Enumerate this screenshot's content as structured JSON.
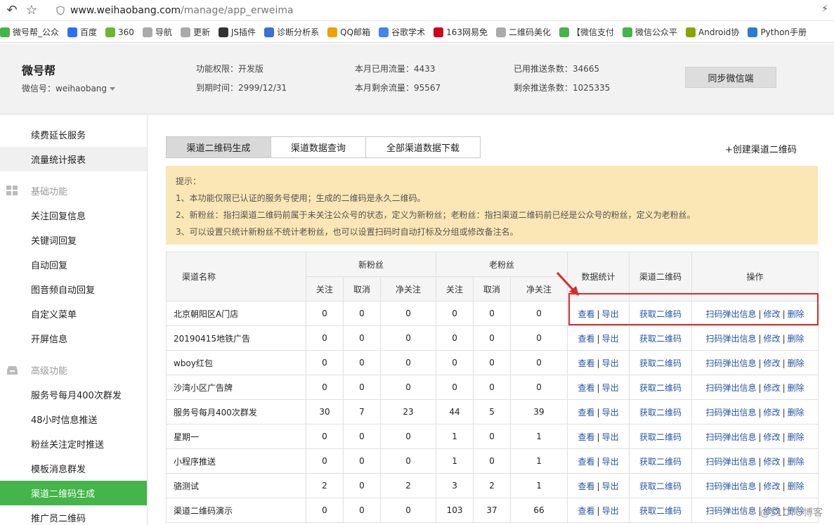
{
  "browser": {
    "url_host": "www.weihaobang.com",
    "url_path": "/manage/app_erweima",
    "bookmarks": [
      {
        "label": "微号帮_公众",
        "icon": "wechat-icon",
        "color": "#44b549"
      },
      {
        "label": "百度",
        "icon": "baidu-icon",
        "color": "#2d6ff7"
      },
      {
        "label": "360",
        "icon": "360-icon",
        "color": "#6ab82e"
      },
      {
        "label": "导航",
        "icon": "page-icon",
        "color": "#aaaaaa"
      },
      {
        "label": "更新",
        "icon": "page-icon",
        "color": "#aaaaaa"
      },
      {
        "label": "JS插件",
        "icon": "js-icon",
        "color": "#333333"
      },
      {
        "label": "诊断分析系",
        "icon": "diagnose-icon",
        "color": "#3a6fd8"
      },
      {
        "label": "QQ邮箱",
        "icon": "qqmail-icon",
        "color": "#f0a000"
      },
      {
        "label": "谷歌学术",
        "icon": "google-icon",
        "color": "#4285f4"
      },
      {
        "label": "163网易免",
        "icon": "163-icon",
        "color": "#d0021b"
      },
      {
        "label": "二维码美化",
        "icon": "page-icon",
        "color": "#aaaaaa"
      },
      {
        "label": "【微信支付",
        "icon": "wechat-icon",
        "color": "#44b549"
      },
      {
        "label": "微信公众平",
        "icon": "wechat-icon",
        "color": "#44b549"
      },
      {
        "label": "Android协",
        "icon": "android-icon",
        "color": "#8aa400"
      },
      {
        "label": "Python手册",
        "icon": "python-icon",
        "color": "#2b7bd0"
      }
    ]
  },
  "header": {
    "account_name": "微号帮",
    "wechat_id": "微信号：weihaobang",
    "permission": "功能权限：开发版",
    "expire": "到期时间：2999/12/31",
    "used_flow": "本月已用流量：4433",
    "remain_flow": "本月剩余流量：95567",
    "used_push": "已用推送条数：34665",
    "remain_push": "剩余推送条数：1025335",
    "sync_button": "同步微信端"
  },
  "sidebar": {
    "renew": "续费延长服务",
    "flow_report": "流量统计报表",
    "basic_group": "基础功能",
    "basic": [
      "关注回复信息",
      "关键词回复",
      "自动回复",
      "图音频自动回复",
      "自定义菜单",
      "开屏信息"
    ],
    "advanced_group": "高级功能",
    "advanced": [
      "服务号每月400次群发",
      "48小时信息推送",
      "粉丝关注定时推送",
      "模板消息群发",
      "渠道二维码生成",
      "推广员二维码"
    ]
  },
  "tabs": [
    "渠道二维码生成",
    "渠道数据查询",
    "全部渠道数据下载"
  ],
  "create_link": "+创建渠道二维码",
  "tips": {
    "title": "提示：",
    "lines": [
      "1、本功能仅限已认证的服务号使用；生成的二维码是永久二维码。",
      "2、新粉丝：指扫渠道二维码前属于未关注公众号的状态，定义为新粉丝；老粉丝：指扫渠道二维码前已经是公众号的粉丝，定义为老粉丝。",
      "3、可以设置只统计新粉丝不统计老粉丝，也可以设置扫码时自动打标及分组或修改备注名。"
    ]
  },
  "table": {
    "headers": {
      "name": "渠道名称",
      "new_fans": "新粉丝",
      "old_fans": "老粉丝",
      "stats": "数据统计",
      "qrcode": "渠道二维码",
      "ops": "操作",
      "follow": "关注",
      "cancel": "取消",
      "net": "净关注"
    },
    "actions": {
      "view": "查看",
      "export": "导出",
      "get_qr": "获取二维码",
      "popup": "扫码弹出信息",
      "edit": "修改",
      "delete": "删除",
      "sep": "|"
    },
    "rows": [
      {
        "name": "北京朝阳区A门店",
        "n": [
          "0",
          "0",
          "0"
        ],
        "o": [
          "0",
          "0",
          "0"
        ]
      },
      {
        "name": "20190415地铁广告",
        "n": [
          "0",
          "0",
          "0"
        ],
        "o": [
          "0",
          "0",
          "0"
        ]
      },
      {
        "name": "wboy红包",
        "n": [
          "0",
          "0",
          "0"
        ],
        "o": [
          "0",
          "0",
          "0"
        ]
      },
      {
        "name": "沙湾小区广告牌",
        "n": [
          "0",
          "0",
          "0"
        ],
        "o": [
          "0",
          "0",
          "0"
        ]
      },
      {
        "name": "服务号每月400次群发",
        "n": [
          "30",
          "7",
          "23"
        ],
        "o": [
          "44",
          "5",
          "39"
        ]
      },
      {
        "name": "星期一",
        "n": [
          "0",
          "0",
          "0"
        ],
        "o": [
          "1",
          "0",
          "1"
        ]
      },
      {
        "name": "小程序推送",
        "n": [
          "0",
          "0",
          "0"
        ],
        "o": [
          "1",
          "0",
          "1"
        ]
      },
      {
        "name": "骆测试",
        "n": [
          "2",
          "0",
          "2"
        ],
        "o": [
          "3",
          "2",
          "1"
        ]
      },
      {
        "name": "渠道二维码演示",
        "n": [
          "0",
          "0",
          "0"
        ],
        "o": [
          "103",
          "37",
          "66"
        ]
      }
    ]
  },
  "watermark": "@51CTO博客"
}
